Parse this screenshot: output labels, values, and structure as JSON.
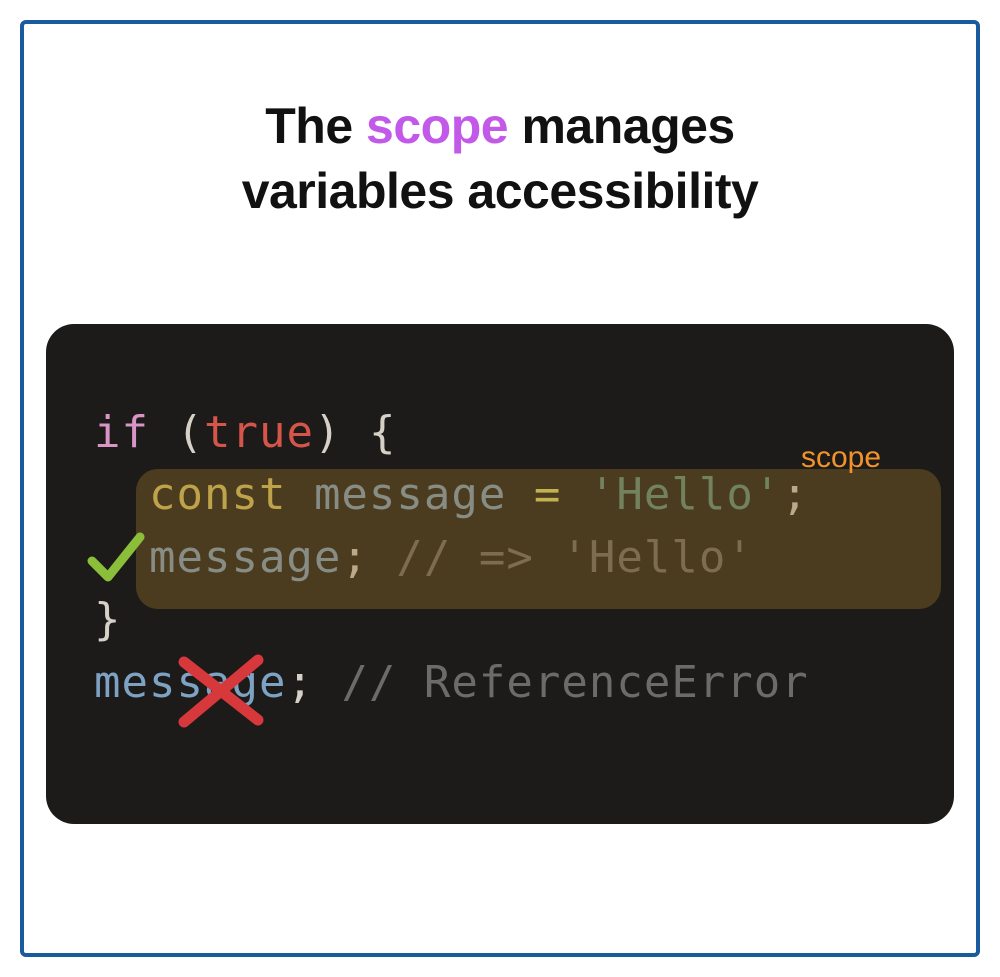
{
  "title": {
    "before": "The ",
    "highlight": "scope",
    "after": " manages",
    "line2": "variables accessibility"
  },
  "code": {
    "l1": {
      "kw": "if",
      "paren_open": "(",
      "val": "true",
      "paren_close": ")",
      "brace_open": "{"
    },
    "l2": {
      "const": "const",
      "ident": "message",
      "op": "=",
      "str": "'Hello'",
      "punc": ";"
    },
    "l3": {
      "ident": "message",
      "punc": ";",
      "cmt": "// => 'Hello'"
    },
    "l4": {
      "brace_close": "}"
    },
    "l5": {
      "ident": "message",
      "punc": ";",
      "cmt": "// ReferenceError"
    }
  },
  "annotations": {
    "scope_label": "scope",
    "check": "check",
    "cross": "cross"
  },
  "colors": {
    "border": "#1a5a9e",
    "highlight": "#c259e8",
    "codebg": "#1c1b1a",
    "scope_overlay": "rgba(150,110,40,0.40)",
    "scope_label": "#f2922a",
    "check": "#8bbf3a",
    "cross": "#d6383c"
  }
}
